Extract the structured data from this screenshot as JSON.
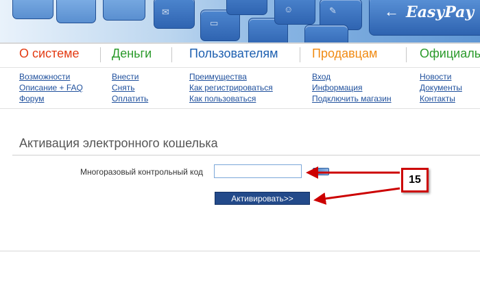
{
  "banner": {
    "brand": "EasyPay"
  },
  "nav": {
    "columns": [
      {
        "title": "О системе",
        "color": "#e33b13",
        "links": [
          "Возможности",
          "Описание + FAQ",
          "Форум"
        ]
      },
      {
        "title": "Деньги",
        "color": "#2a9a2a",
        "links": [
          "Внести",
          "Снять",
          "Оплатить"
        ]
      },
      {
        "title": "Пользователям",
        "color": "#1d5fb0",
        "links": [
          "Преимущества",
          "Как регистрироваться",
          "Как пользоваться"
        ]
      },
      {
        "title": "Продавцам",
        "color": "#f08a12",
        "links": [
          "Вход",
          "Информация",
          "Подключить магазин"
        ]
      },
      {
        "title": "Официальн",
        "color": "#2a9a2a",
        "links": [
          "Новости",
          "Документы",
          "Контакты"
        ]
      }
    ]
  },
  "page": {
    "title": "Активация электронного кошелька"
  },
  "form": {
    "code_label": "Многоразовый контрольный код",
    "code_value": "",
    "submit_label": "Активировать>>"
  },
  "annotation": {
    "label": "15",
    "color": "#cc0000"
  }
}
